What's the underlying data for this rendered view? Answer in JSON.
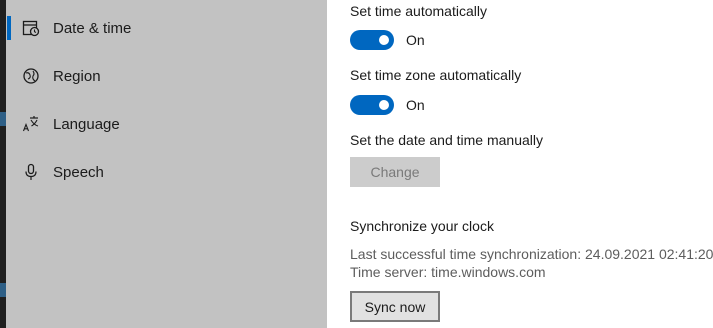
{
  "sidebar": {
    "items": [
      {
        "label": "Date & time",
        "icon": "calendar-clock-icon",
        "selected": true
      },
      {
        "label": "Region",
        "icon": "globe-icon",
        "selected": false
      },
      {
        "label": "Language",
        "icon": "language-icon",
        "selected": false
      },
      {
        "label": "Speech",
        "icon": "microphone-icon",
        "selected": false
      }
    ]
  },
  "settings": {
    "auto_time": {
      "label": "Set time automatically",
      "state": "On",
      "enabled": true
    },
    "auto_timezone": {
      "label": "Set time zone automatically",
      "state": "On",
      "enabled": true
    },
    "manual": {
      "label": "Set the date and time manually",
      "button": "Change",
      "disabled": true
    }
  },
  "sync": {
    "heading": "Synchronize your clock",
    "last_sync": "Last successful time synchronization: 24.09.2021 02:41:20",
    "server": "Time server: time.windows.com",
    "button": "Sync now"
  },
  "colors": {
    "accent": "#0067c0",
    "sidebar_bg": "#c2c2c2",
    "content_bg": "#ffffff"
  }
}
